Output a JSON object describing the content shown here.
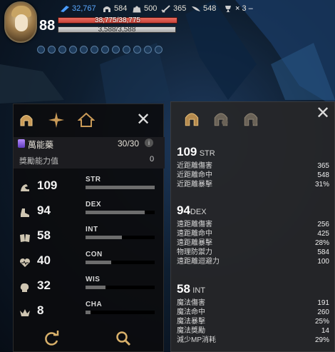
{
  "hud": {
    "level": "88",
    "resources": [
      {
        "icon": "gem-icon",
        "value": "32,767",
        "color": "#5aa8ff"
      },
      {
        "icon": "helmet-icon",
        "value": "584",
        "color": "#ffffff"
      },
      {
        "icon": "bag-icon",
        "value": "500",
        "color": "#ffffff"
      },
      {
        "icon": "sword-icon",
        "value": "365",
        "color": "#ffffff"
      },
      {
        "icon": "wing-icon",
        "value": "548",
        "color": "#ffffff"
      },
      {
        "icon": "trophy-icon",
        "value": "3",
        "color": "#ffffff"
      }
    ],
    "hp": {
      "text": "38,775/38,775",
      "fraction": 1.0,
      "color": "#d9473d"
    },
    "mp": {
      "text": "3,588/3,588",
      "fraction": 1.0,
      "color": "#c4c4c4"
    },
    "buff_count": 12
  },
  "left_panel": {
    "tabs": [
      "helmet-tab-icon",
      "compass-star-tab-icon",
      "house-tab-icon"
    ],
    "elixir": {
      "name": "萬能藥",
      "count": "30/30",
      "info": "i",
      "bonus_label": "獎勵能力值",
      "bonus_value": "0"
    },
    "stats": [
      {
        "value": "109",
        "code": "STR",
        "fill": 1.0,
        "icon": "arm-icon"
      },
      {
        "value": "94",
        "code": "DEX",
        "fill": 0.86,
        "icon": "boot-icon"
      },
      {
        "value": "58",
        "code": "INT",
        "fill": 0.53,
        "icon": "book-icon"
      },
      {
        "value": "40",
        "code": "CON",
        "fill": 0.37,
        "icon": "heart-icon"
      },
      {
        "value": "32",
        "code": "WIS",
        "fill": 0.29,
        "icon": "head-icon"
      },
      {
        "value": "8",
        "code": "CHA",
        "fill": 0.07,
        "icon": "crown-icon"
      }
    ],
    "footer": [
      "refresh-icon",
      "search-icon"
    ]
  },
  "right_panel": {
    "tabs": [
      "helmet-icon",
      "helmet-plus-icon",
      "helmet-shield-icon"
    ],
    "groups": [
      {
        "value": "109",
        "code": "STR",
        "rows": [
          {
            "label": "近距離傷害",
            "value": "365"
          },
          {
            "label": "近距離命中",
            "value": "548"
          },
          {
            "label": "近距離暴擊",
            "value": "31%"
          }
        ]
      },
      {
        "value": "94",
        "code": "DEX",
        "rows": [
          {
            "label": "遠距離傷害",
            "value": "256"
          },
          {
            "label": "遠距離命中",
            "value": "425"
          },
          {
            "label": "遠距離暴擊",
            "value": "28%"
          },
          {
            "label": "物理防禦力",
            "value": "584"
          },
          {
            "label": "遠距離迴避力",
            "value": "100"
          }
        ]
      },
      {
        "value": "58",
        "code": "INT",
        "rows": [
          {
            "label": "魔法傷害",
            "value": "191"
          },
          {
            "label": "魔法命中",
            "value": "260"
          },
          {
            "label": "魔法暴擊",
            "value": "25%"
          },
          {
            "label": "魔法獎勵",
            "value": "14"
          },
          {
            "label": "減少MP消耗",
            "value": "29%"
          }
        ]
      }
    ]
  }
}
